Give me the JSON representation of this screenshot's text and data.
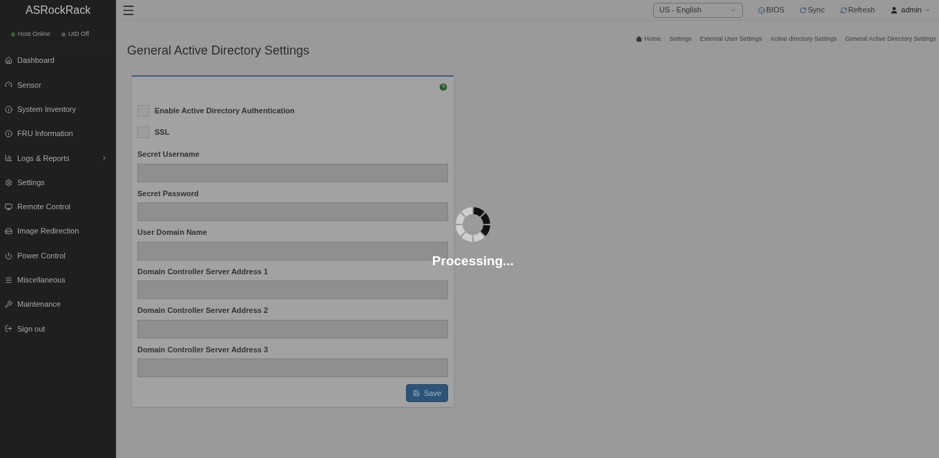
{
  "brand": "ASRockRack",
  "status": [
    {
      "label": "Host Online",
      "color": "#2e6b2e"
    },
    {
      "label": "UID Off",
      "color": "#555555"
    }
  ],
  "nav": [
    {
      "label": "Dashboard",
      "has_children": false
    },
    {
      "label": "Sensor",
      "has_children": false
    },
    {
      "label": "System Inventory",
      "has_children": false
    },
    {
      "label": "FRU Information",
      "has_children": false
    },
    {
      "label": "Logs & Reports",
      "has_children": true
    },
    {
      "label": "Settings",
      "has_children": false
    },
    {
      "label": "Remote Control",
      "has_children": false
    },
    {
      "label": "Image Redirection",
      "has_children": false
    },
    {
      "label": "Power Control",
      "has_children": false
    },
    {
      "label": "Miscellaneous",
      "has_children": false
    },
    {
      "label": "Maintenance",
      "has_children": false
    },
    {
      "label": "Sign out",
      "has_children": false
    }
  ],
  "topbar": {
    "language": "US - English",
    "links": [
      {
        "label": "BIOS"
      },
      {
        "label": "Sync"
      },
      {
        "label": "Refresh"
      }
    ],
    "user": "admin"
  },
  "breadcrumb": [
    "Home",
    "Settings",
    "External User Settings",
    "Active directory Settings",
    "General Active Directory Settings"
  ],
  "title": "General Active Directory Settings",
  "checkboxes": [
    {
      "label": "Enable Active Directory Authentication",
      "checked": false
    },
    {
      "label": "SSL",
      "checked": false
    }
  ],
  "fields": [
    {
      "label": "Secret Username"
    },
    {
      "label": "Secret Password"
    },
    {
      "label": "User Domain Name"
    },
    {
      "label": "Domain Controller Server Address 1"
    },
    {
      "label": "Domain Controller Server Address 2"
    },
    {
      "label": "Domain Controller Server Address 3"
    }
  ],
  "save_button": "Save",
  "overlay": {
    "message": "Processing..."
  }
}
